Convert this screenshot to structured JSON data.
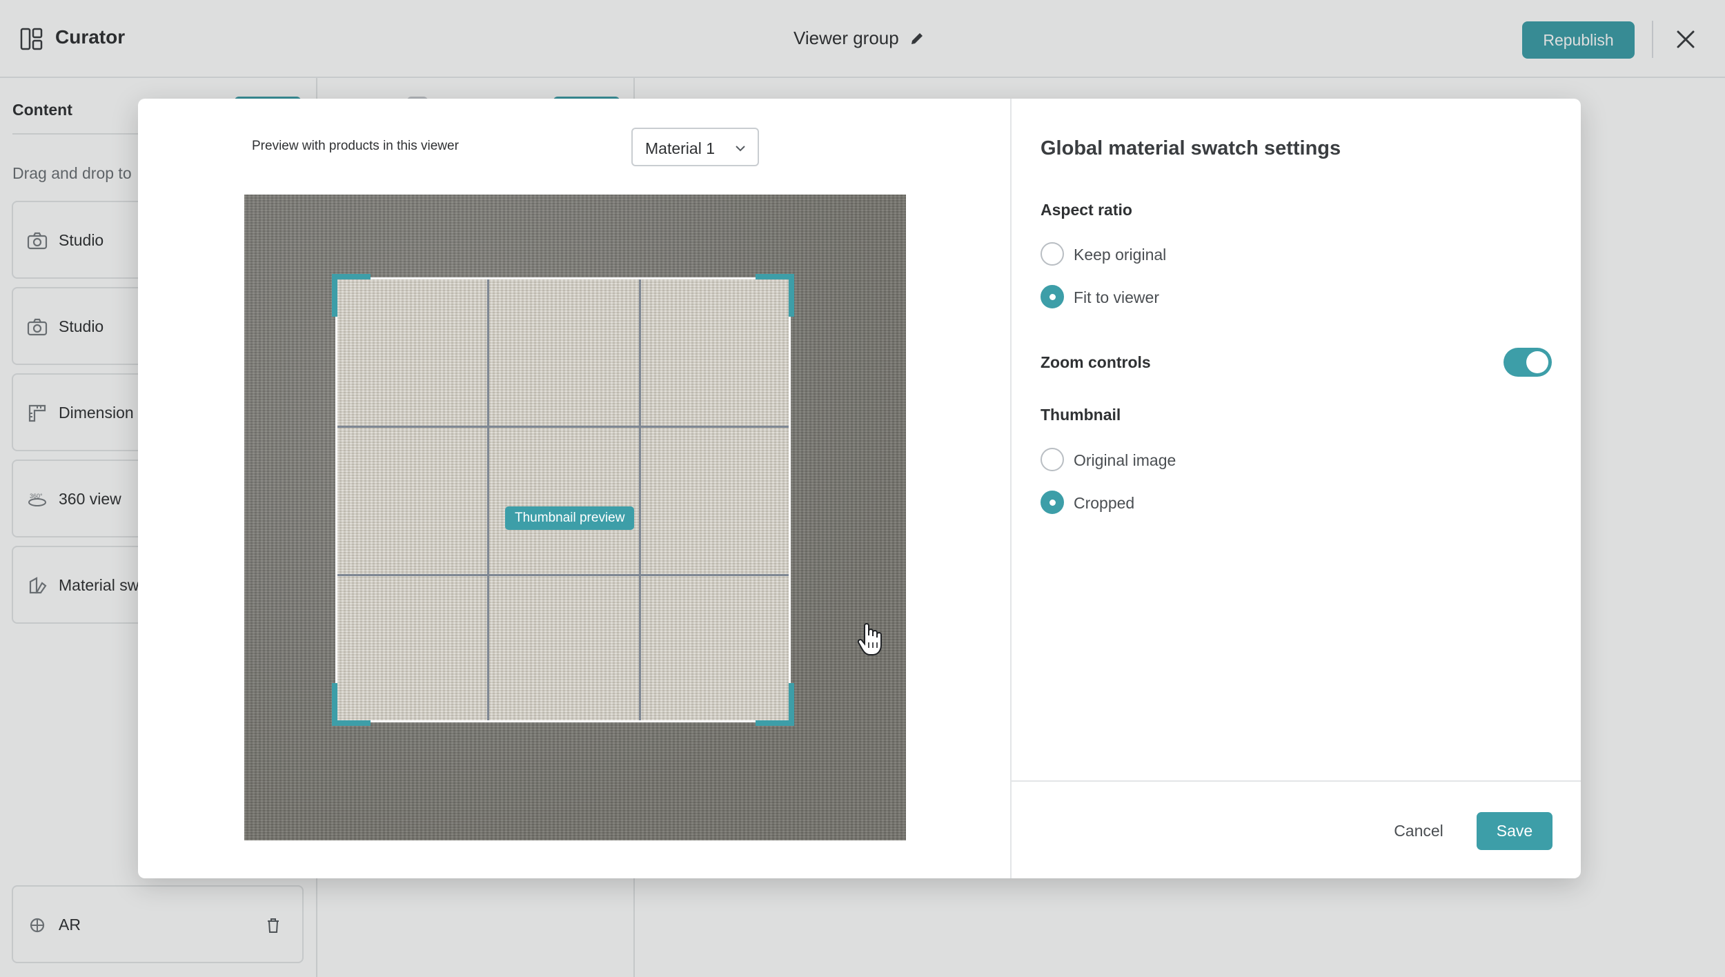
{
  "app": {
    "title": "Curator",
    "group_name": "Viewer group",
    "republish_label": "Republish",
    "accent_color": "#3d9ea8"
  },
  "content_panel": {
    "title": "Content",
    "hint": "Drag and drop to",
    "items": [
      {
        "label": "Studio",
        "icon": "camera-icon"
      },
      {
        "label": "Studio",
        "icon": "camera-icon"
      },
      {
        "label": "Dimension",
        "icon": "ruler-icon"
      },
      {
        "label": "360 view",
        "icon": "360-icon"
      },
      {
        "label": "Material sw",
        "icon": "swatch-icon"
      }
    ],
    "ar_item": {
      "label": "AR",
      "icon": "ar-icon"
    }
  },
  "modal": {
    "preview_label": "Preview with products in this viewer",
    "material_select": {
      "value": "Material 1"
    },
    "thumbnail_preview_label": "Thumbnail preview",
    "settings": {
      "title": "Global material swatch settings",
      "aspect_ratio": {
        "label": "Aspect ratio",
        "options": [
          {
            "label": "Keep original",
            "checked": false
          },
          {
            "label": "Fit to viewer",
            "checked": true
          }
        ]
      },
      "zoom_controls": {
        "label": "Zoom controls",
        "enabled": true
      },
      "thumbnail": {
        "label": "Thumbnail",
        "options": [
          {
            "label": "Original image",
            "checked": false
          },
          {
            "label": "Cropped",
            "checked": true
          }
        ]
      }
    },
    "cancel_label": "Cancel",
    "save_label": "Save"
  }
}
